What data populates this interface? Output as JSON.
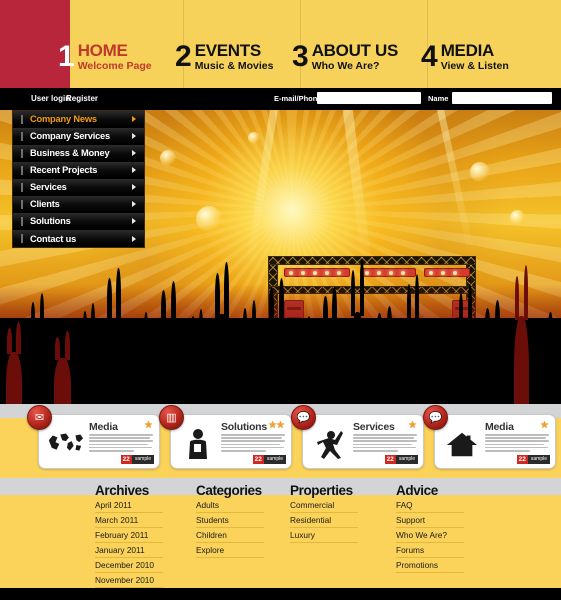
{
  "brand": {
    "accent_red": "#b7263b",
    "accent_yellow": "#f6d25a",
    "accent_orange": "#f39c12"
  },
  "topnav": {
    "items": [
      {
        "num": "1",
        "title": "HOME",
        "sub": "Welcome Page",
        "active": true
      },
      {
        "num": "2",
        "title": "EVENTS",
        "sub": "Music & Movies",
        "active": false
      },
      {
        "num": "3",
        "title": "ABOUT US",
        "sub": "Who We Are?",
        "active": false
      },
      {
        "num": "4",
        "title": "MEDIA",
        "sub": "View & Listen",
        "active": false
      }
    ]
  },
  "userstrip": {
    "user_login": "User login",
    "register": "Register",
    "email_label": "E-mail/Phone",
    "email_value": "",
    "email_placeholder": "",
    "name_label": "Name",
    "name_value": "",
    "name_placeholder": ""
  },
  "sidemenu": {
    "items": [
      {
        "label": "Company News",
        "active": true,
        "icon": "chevron-right-icon"
      },
      {
        "label": "Company Services",
        "active": false,
        "icon": "chevron-right-icon"
      },
      {
        "label": "Business & Money",
        "active": false,
        "icon": "chevron-right-icon"
      },
      {
        "label": "Recent Projects",
        "active": false,
        "icon": "chevron-right-icon"
      },
      {
        "label": "Services",
        "active": false,
        "icon": "chevron-right-icon"
      },
      {
        "label": "Clients",
        "active": false,
        "icon": "chevron-right-icon"
      },
      {
        "label": "Solutions",
        "active": false,
        "icon": "chevron-right-icon"
      },
      {
        "label": "Contact us",
        "active": false,
        "icon": "chevron-right-icon"
      }
    ]
  },
  "cards": [
    {
      "title": "Media",
      "badge_icon": "envelope-icon",
      "glyph": "world-map-icon",
      "stars": "★",
      "tag_num": "22",
      "tag_text": "sample"
    },
    {
      "title": "Solutions",
      "badge_icon": "chart-bars-icon",
      "glyph": "person-icon",
      "stars": "★★",
      "tag_num": "22",
      "tag_text": "sample"
    },
    {
      "title": "Services",
      "badge_icon": "speech-bubble-icon",
      "glyph": "jumping-person-icon",
      "stars": "★",
      "tag_num": "22",
      "tag_text": "sample"
    },
    {
      "title": "Media",
      "badge_icon": "speech-bubble-icon",
      "glyph": "house-icon",
      "stars": "★",
      "tag_num": "22",
      "tag_text": "sample"
    }
  ],
  "footer": {
    "columns": [
      {
        "heading": "Archives",
        "links": [
          "April 2011",
          "March 2011",
          "February 2011",
          "January 2011",
          "December 2010",
          "November 2010"
        ]
      },
      {
        "heading": "Categories",
        "links": [
          "Adults",
          "Students",
          "Children",
          "Explore"
        ]
      },
      {
        "heading": "Properties",
        "links": [
          "Commercial",
          "Residential",
          "Luxury"
        ]
      },
      {
        "heading": "Advice",
        "links": [
          "FAQ",
          "Support",
          "Who We Are?",
          "Forums",
          "Promotions"
        ]
      }
    ]
  }
}
